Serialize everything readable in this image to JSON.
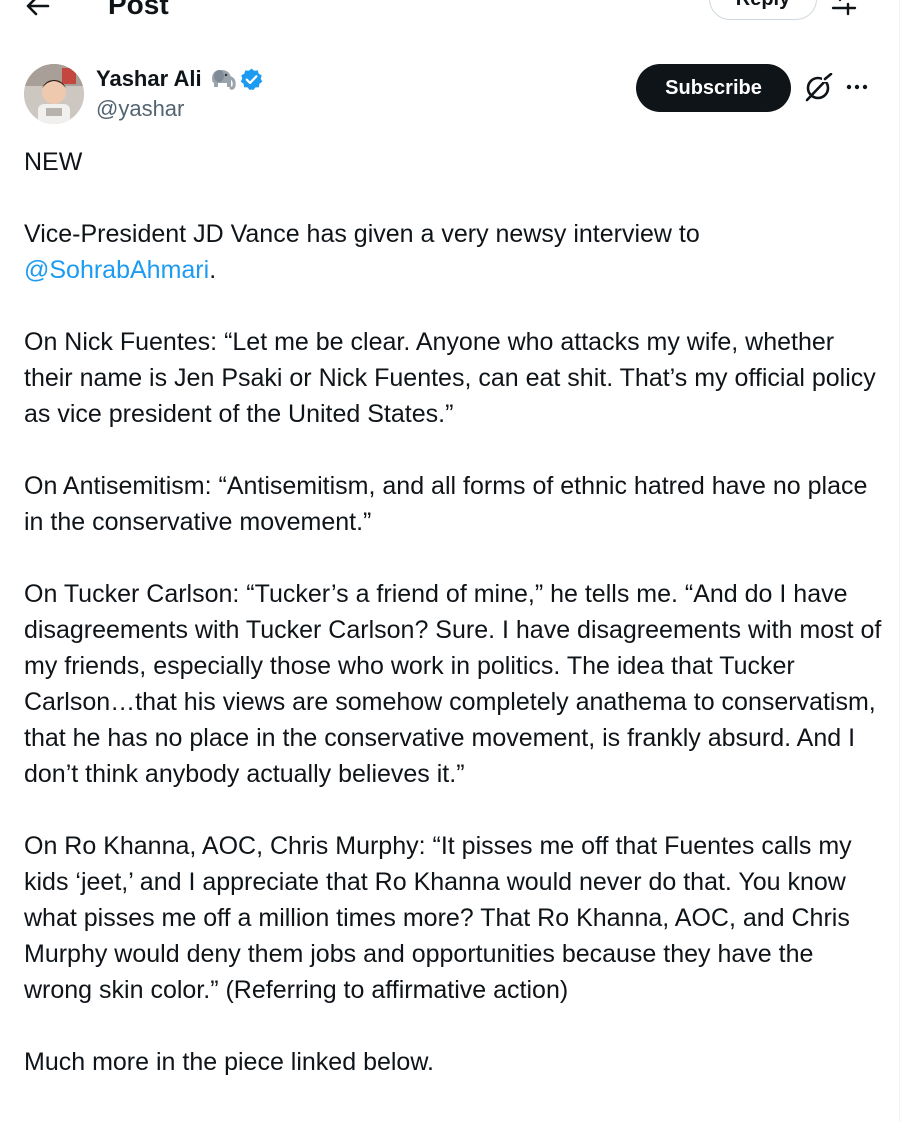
{
  "header": {
    "title": "Post",
    "reply_label": "Reply"
  },
  "author": {
    "name": "Yashar Ali",
    "handle": "@yashar",
    "subscribe_label": "Subscribe"
  },
  "post": {
    "p1": "NEW",
    "p2_before": "Vice-President JD Vance has given a very newsy interview to ",
    "p2_mention": "@SohrabAhmari",
    "p2_after": ".",
    "p3": "On Nick Fuentes: “Let me be clear. Anyone who attacks my wife, whether their name is Jen Psaki or Nick Fuentes, can eat shit. That’s my official policy as vice president of the United States.”",
    "p4": "On Antisemitism: “Antisemitism, and all forms of ethnic hatred have no place in the conservative movement.”",
    "p5": "On Tucker Carlson: “Tucker’s a friend of mine,” he tells me. “And do I have disagreements with Tucker Carlson? Sure. I have disagreements with most of my friends, especially those who work in politics. The idea that Tucker Carlson…that his views are somehow completely anathema to conservatism, that he has no place in the conservative movement, is frankly absurd. And I don’t think anybody actually believes it.”",
    "p6": "On Ro Khanna, AOC, Chris Murphy: “It pisses me off that Fuentes calls my kids ‘jeet,’ and I appreciate that Ro Khanna would never do that. You know what pisses me off a million times more? That Ro Khanna, AOC, and Chris Murphy would deny them jobs and opportunities because they have the wrong skin color.” (Referring to affirmative action)",
    "p7": "Much more in the piece linked below."
  },
  "colors": {
    "link": "#1d9bf0",
    "verified": "#1d9bf0",
    "text": "#0f1419",
    "secondary": "#536471",
    "button_dark": "#0f1419"
  },
  "icons": [
    "back-arrow-icon",
    "settings-icon",
    "elephant-icon",
    "verified-badge-icon",
    "grok-icon",
    "more-options-icon"
  ]
}
